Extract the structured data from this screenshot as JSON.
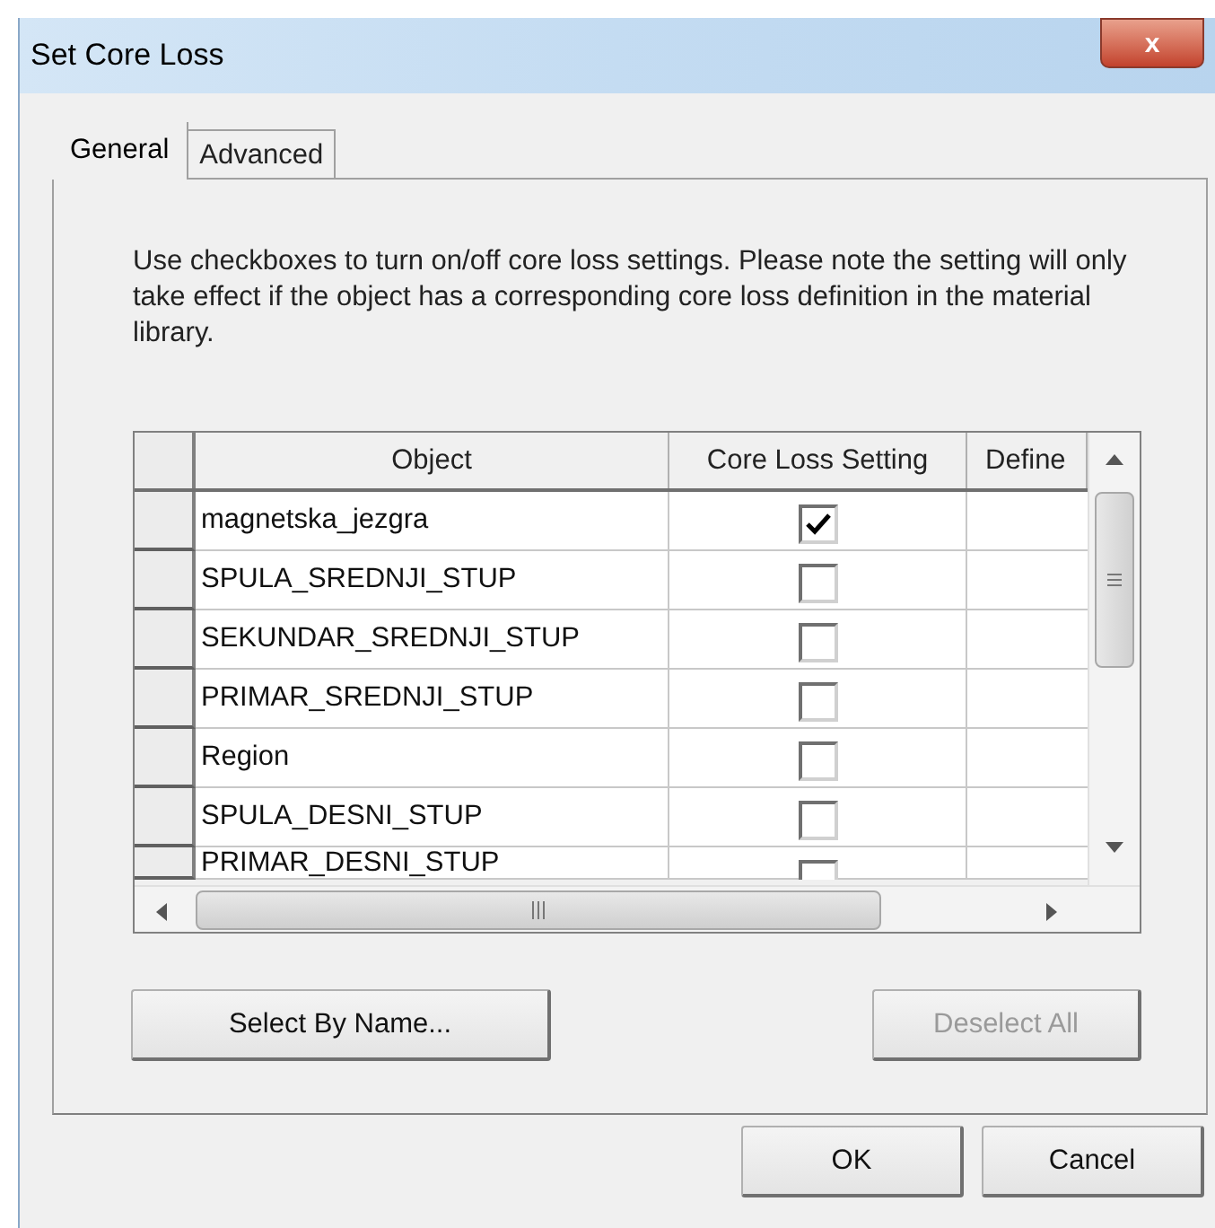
{
  "window": {
    "title": "Set Core Loss",
    "close": "x"
  },
  "tabs": [
    {
      "label": "General",
      "selected": true
    },
    {
      "label": "Advanced",
      "selected": false
    }
  ],
  "description": "Use checkboxes to turn on/off core loss settings.  Please note the setting will only take effect if the object has a corresponding core loss definition in the material library.",
  "table": {
    "columns": [
      "Object",
      "Core Loss Setting",
      "Define"
    ],
    "rows": [
      {
        "object": "magnetska_jezgra",
        "checked": true
      },
      {
        "object": "SPULA_SREDNJI_STUP",
        "checked": false
      },
      {
        "object": "SEKUNDAR_SREDNJI_STUP",
        "checked": false
      },
      {
        "object": "PRIMAR_SREDNJI_STUP",
        "checked": false
      },
      {
        "object": "Region",
        "checked": false
      },
      {
        "object": "SPULA_DESNI_STUP",
        "checked": false
      },
      {
        "object": "PRIMAR_DESNI_STUP",
        "checked": false,
        "partial": true
      }
    ]
  },
  "panel_buttons": [
    {
      "label": "Select By Name...",
      "disabled": false
    },
    {
      "label": "Deselect All",
      "disabled": true
    }
  ],
  "buttons": [
    {
      "label": "OK"
    },
    {
      "label": "Cancel"
    }
  ]
}
